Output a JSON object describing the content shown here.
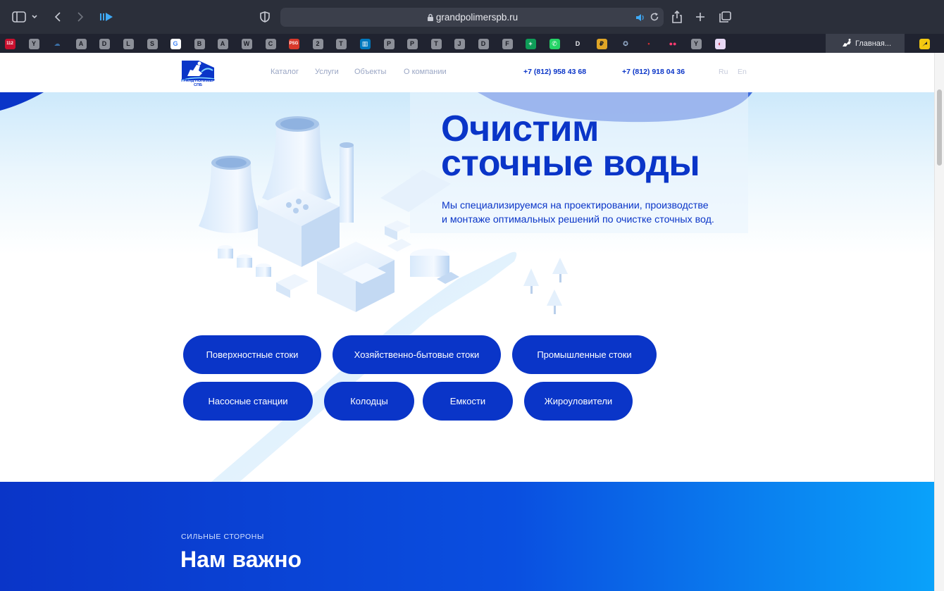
{
  "browser": {
    "url": "grandpolimerspb.ru",
    "tab_favicons": [
      {
        "label": "112",
        "bg": "#c8102e",
        "fg": "#ffffff"
      },
      {
        "label": "Y",
        "bg": "#8c8f98",
        "fg": "#1c1e26"
      },
      {
        "label": "☁",
        "bg": "#202330",
        "fg": "#3a6ea5"
      },
      {
        "label": "A",
        "bg": "#8c8f98",
        "fg": "#1c1e26"
      },
      {
        "label": "D",
        "bg": "#8c8f98",
        "fg": "#1c1e26"
      },
      {
        "label": "L",
        "bg": "#8c8f98",
        "fg": "#1c1e26"
      },
      {
        "label": "S",
        "bg": "#8c8f98",
        "fg": "#1c1e26"
      },
      {
        "label": "G",
        "bg": "#ffffff",
        "fg": "#4285f4"
      },
      {
        "label": "B",
        "bg": "#8c8f98",
        "fg": "#1c1e26"
      },
      {
        "label": "A",
        "bg": "#8c8f98",
        "fg": "#1c1e26"
      },
      {
        "label": "W",
        "bg": "#8c8f98",
        "fg": "#1c1e26"
      },
      {
        "label": "C",
        "bg": "#8c8f98",
        "fg": "#1c1e26"
      },
      {
        "label": "PSG",
        "bg": "#d8392b",
        "fg": "#ffffff"
      },
      {
        "label": "2",
        "bg": "#8c8f98",
        "fg": "#1c1e26"
      },
      {
        "label": "T",
        "bg": "#8c8f98",
        "fg": "#1c1e26"
      },
      {
        "label": "▥",
        "bg": "#0079bf",
        "fg": "#ffffff"
      },
      {
        "label": "P",
        "bg": "#8c8f98",
        "fg": "#1c1e26"
      },
      {
        "label": "P",
        "bg": "#8c8f98",
        "fg": "#1c1e26"
      },
      {
        "label": "T",
        "bg": "#8c8f98",
        "fg": "#1c1e26"
      },
      {
        "label": "J",
        "bg": "#8c8f98",
        "fg": "#1c1e26"
      },
      {
        "label": "D",
        "bg": "#8c8f98",
        "fg": "#1c1e26"
      },
      {
        "label": "F",
        "bg": "#8c8f98",
        "fg": "#1c1e26"
      },
      {
        "label": "+",
        "bg": "#0f9d58",
        "fg": "#ffffff"
      },
      {
        "label": "✆",
        "bg": "#25d366",
        "fg": "#ffffff"
      },
      {
        "label": "D",
        "bg": "#202330",
        "fg": "#e8e9ee"
      },
      {
        "label": "₽",
        "bg": "#e0a526",
        "fg": "#1c1e26"
      },
      {
        "label": "✪",
        "bg": "#202330",
        "fg": "#9fb8d8"
      },
      {
        "label": "•",
        "bg": "#202330",
        "fg": "#d23030"
      },
      {
        "label": "●●",
        "bg": "#202330",
        "fg": "#ff3b70"
      },
      {
        "label": "Y",
        "bg": "#8c8f98",
        "fg": "#1c1e26"
      },
      {
        "label": "◐",
        "bg": "#e8d9f5",
        "fg": "#c0354a"
      }
    ],
    "active_tab": {
      "label": "Главная...",
      "favicon": "horse-rider-logo"
    },
    "last_tab": {
      "favicon": "arrow-icon",
      "bg": "#f2c811"
    }
  },
  "header": {
    "logo_caption": "ГРАНД ПОЛИМЕР СПБ",
    "nav": [
      "Каталог",
      "Услуги",
      "Объекты",
      "О компании"
    ],
    "phones": [
      "+7 (812) 958 43 68",
      "+7 (812) 918 04 36"
    ],
    "languages": [
      "Ru",
      "En"
    ]
  },
  "hero": {
    "title_line1": "Очистим",
    "title_line2": "сточные воды",
    "subtitle_line1": "Мы специализируемся на проектировании, производстве",
    "subtitle_line2": "и монтаже оптимальных решений по очистке сточных вод.",
    "buttons_row1": [
      "Поверхностные стоки",
      "Хозяйственно-бытовые стоки",
      "Промышленные стоки"
    ],
    "buttons_row2": [
      "Насосные станции",
      "Колодцы",
      "Емкости",
      "Жироуловители"
    ]
  },
  "strengths": {
    "label": "СИЛЬНЫЕ СТОРОНЫ",
    "title": "Нам важно"
  },
  "colors": {
    "brand_blue": "#0a35c8",
    "nav_gray": "#9aa6c4",
    "chrome_bg": "#2b2f3a",
    "tabbar_bg": "#202330"
  }
}
